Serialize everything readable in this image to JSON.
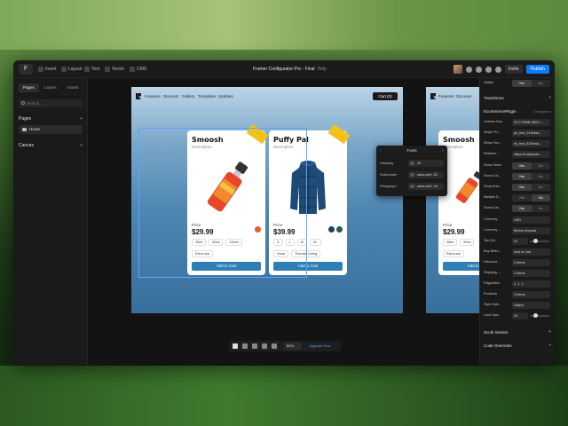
{
  "app": {
    "menu_label": "F",
    "tools": [
      "Insert",
      "Layout",
      "Text",
      "Vector",
      "CMS"
    ],
    "project_title": "Framer Configurator Pro - Final",
    "project_subtitle": "Help",
    "invite_label": "Invite",
    "publish_label": "Publish"
  },
  "left_panel": {
    "tabs": [
      "Pages",
      "Layers",
      "Assets"
    ],
    "search_placeholder": "Search...",
    "pages_label": "Pages",
    "page_item": "Home",
    "canvas_label": "Canvas"
  },
  "site": {
    "nav_links": [
      "Features",
      "Discover",
      "Gallery",
      "Templates",
      "Updates"
    ],
    "cart_label": "Cart (0)",
    "cards": [
      {
        "name": "Smoosh",
        "description": "Description",
        "price_label": "Price",
        "price": "$29.99",
        "sizes": [
          "25ml",
          "50ml",
          "100ml"
        ],
        "extras": [
          "Extra one"
        ],
        "add_to_cart": "Add to Cart",
        "swatches": [
          "#e0612a"
        ]
      },
      {
        "name": "Puffy Pal",
        "description": "Description",
        "price_label": "Price",
        "price": "$39.99",
        "sizes": [
          "S",
          "L",
          "M",
          "XL"
        ],
        "extras": [
          "Hood",
          "Thermal Lining"
        ],
        "add_to_cart": "Add to Cart",
        "swatches": [
          "#1e3f63",
          "#2d5a3e"
        ]
      }
    ],
    "partial_card": {
      "name": "Smoosh",
      "description": "Description",
      "price_label": "Price",
      "price": "$29.99",
      "sizes": [
        "25ml",
        "50ml"
      ],
      "extras": [
        "Extra one"
      ],
      "add_to_cart": "Add to Cart"
    }
  },
  "fonts_popup": {
    "title": "Fonts",
    "rows": [
      {
        "label": "Heading",
        "value": "20"
      },
      {
        "label": "Subheader",
        "value": "sans-serif, 20"
      },
      {
        "label": "Paragraph",
        "value": "sans-serif, 16"
      }
    ]
  },
  "zoom_bar": {
    "zoom": "82%",
    "upgrade_label": "Upgrade Now"
  },
  "right_panel": {
    "visible_label": "Visible",
    "visible_options": [
      "Yes",
      "No"
    ],
    "transforms_label": "Transforms",
    "ecommerce_label": "EcommercePlugin",
    "ecommerce_sub": "Untargeted",
    "rows": [
      {
        "label": "License Key",
        "value": "3CC7050B-0BD7-..."
      },
      {
        "label": "Stripe Pu...",
        "value": "pk_test_51Rdwd..."
      },
      {
        "label": "Stripe Sec...",
        "value": "sk_test_51Rdwd..."
      },
      {
        "label": "Redirect ...",
        "value": "https://todoprodu..."
      }
    ],
    "toggles": [
      {
        "label": "Show Sizes",
        "options": [
          "Yes",
          "No"
        ],
        "selected": "Yes"
      },
      {
        "label": "Show Col...",
        "options": [
          "Yes",
          "No"
        ],
        "selected": "Yes"
      },
      {
        "label": "Show Extr...",
        "options": [
          "Yes",
          "No"
        ],
        "selected": "Yes"
      },
      {
        "label": "Multiple E...",
        "options": [
          "Yes",
          "No"
        ],
        "selected": "No"
      },
      {
        "label": "Show Car...",
        "options": [
          "Yes",
          "No"
        ],
        "selected": "Yes"
      }
    ],
    "currency_label": "Currency",
    "currency_value": "USD",
    "currency_pos_label": "Currency ...",
    "currency_pos_value": "Before Amount",
    "tax_label": "Tax (%)",
    "tax_value": "21",
    "buy_button_label": "Buy Butto...",
    "buy_button_value": "Add to Cart",
    "discount_label": "Discount ...",
    "discount_value": "2 Items",
    "shipping_label": "Shipping ...",
    "shipping_value": "2 Items",
    "pagination_label": "Pagination",
    "pagination_value": "2, 1, 2",
    "products_label": "Products",
    "products_value": "3 Items",
    "style_label": "Style Opti...",
    "style_value": "Object",
    "card_spacing_label": "Card Spa...",
    "card_spacing_value": "20",
    "scroll_section_label": "Scroll Section",
    "code_overrides_label": "Code Overrides"
  }
}
